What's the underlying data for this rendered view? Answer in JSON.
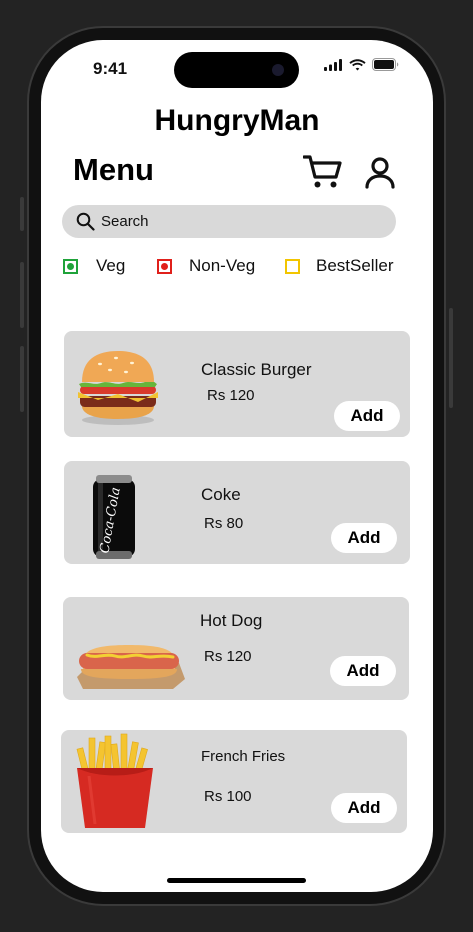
{
  "status_bar": {
    "time": "9:41"
  },
  "app": {
    "title": "HungryMan"
  },
  "header": {
    "heading": "Menu"
  },
  "search": {
    "placeholder": "Search"
  },
  "filters": [
    {
      "label": "Veg",
      "color": "#1fa33a"
    },
    {
      "label": "Non-Veg",
      "color": "#e0201b"
    },
    {
      "label": "BestSeller",
      "color": "#f2c500"
    }
  ],
  "items": [
    {
      "name": "Classic Burger",
      "price": "Rs 120",
      "add_label": "Add",
      "icon": "burger-image"
    },
    {
      "name": "Coke",
      "price": "Rs 80",
      "add_label": "Add",
      "icon": "coke-can-image"
    },
    {
      "name": "Hot Dog",
      "price": "Rs 120",
      "add_label": "Add",
      "icon": "hotdog-image"
    },
    {
      "name": "French Fries",
      "price": "Rs 100",
      "add_label": "Add",
      "icon": "fries-image"
    }
  ]
}
